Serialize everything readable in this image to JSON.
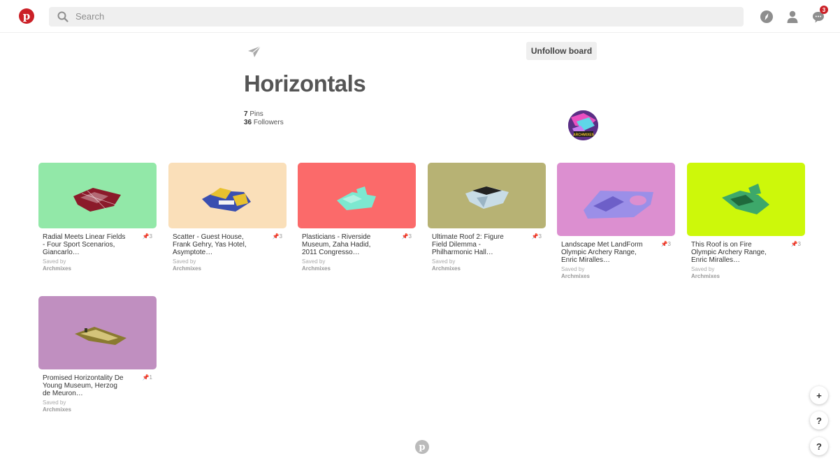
{
  "header": {
    "logo": "p",
    "search_placeholder": "Search",
    "notification_count": "3",
    "icons": [
      "pinterest-logo-icon",
      "search-icon",
      "explore-compass-icon",
      "profile-icon",
      "messages-icon"
    ]
  },
  "board": {
    "title": "Horizontals",
    "pins_count": "7",
    "pins_label": "Pins",
    "followers_count": "36",
    "followers_label": "Followers",
    "unfollow_label": "Unfollow board",
    "avatar_text": "ARCHMIXES"
  },
  "pins": [
    {
      "title": "Radial Meets Linear Fields - Four Sport Scenarios, Giancarlo…",
      "count": "3",
      "saved_label": "Saved by",
      "saver": "Archmixes",
      "bg": "#92e8a8",
      "model": "#8b1a2a"
    },
    {
      "title": "Scatter - Guest House, Frank Gehry, Yas Hotel, Asymptote…",
      "count": "3",
      "saved_label": "Saved by",
      "saver": "Archmixes",
      "bg": "#fadfb9",
      "model": "#e8c12f"
    },
    {
      "title": "Plasticians - Riverside Museum, Zaha Hadid, 2011 Congresso…",
      "count": "3",
      "saved_label": "Saved by",
      "saver": "Archmixes",
      "bg": "#fb6a6a",
      "model": "#7de8d0"
    },
    {
      "title": "Ultimate Roof 2: Figure Field Dilemma - Philharmonic Hall…",
      "count": "3",
      "saved_label": "Saved by",
      "saver": "Archmixes",
      "bg": "#b7b274",
      "model": "#c8dce6"
    },
    {
      "title": "Landscape Met LandForm Olympic Archery Range, Enric Miralles…",
      "count": "3",
      "saved_label": "Saved by",
      "saver": "Archmixes",
      "bg": "#dc8fd0",
      "model": "#9b8fe8"
    },
    {
      "title": "This Roof is on Fire Olympic Archery Range, Enric Miralles…",
      "count": "3",
      "saved_label": "Saved by",
      "saver": "Archmixes",
      "bg": "#cdf80a",
      "model": "#3da86a"
    },
    {
      "title": "Promised Horizontality De Young Museum, Herzog de Meuron…",
      "count": "1",
      "saved_label": "Saved by",
      "saver": "Archmixes",
      "bg": "#c08fc0",
      "model": "#8a7a30"
    }
  ],
  "fab": {
    "add": "+",
    "help1": "?",
    "help2": "?"
  },
  "footer": {
    "logo": "p"
  }
}
